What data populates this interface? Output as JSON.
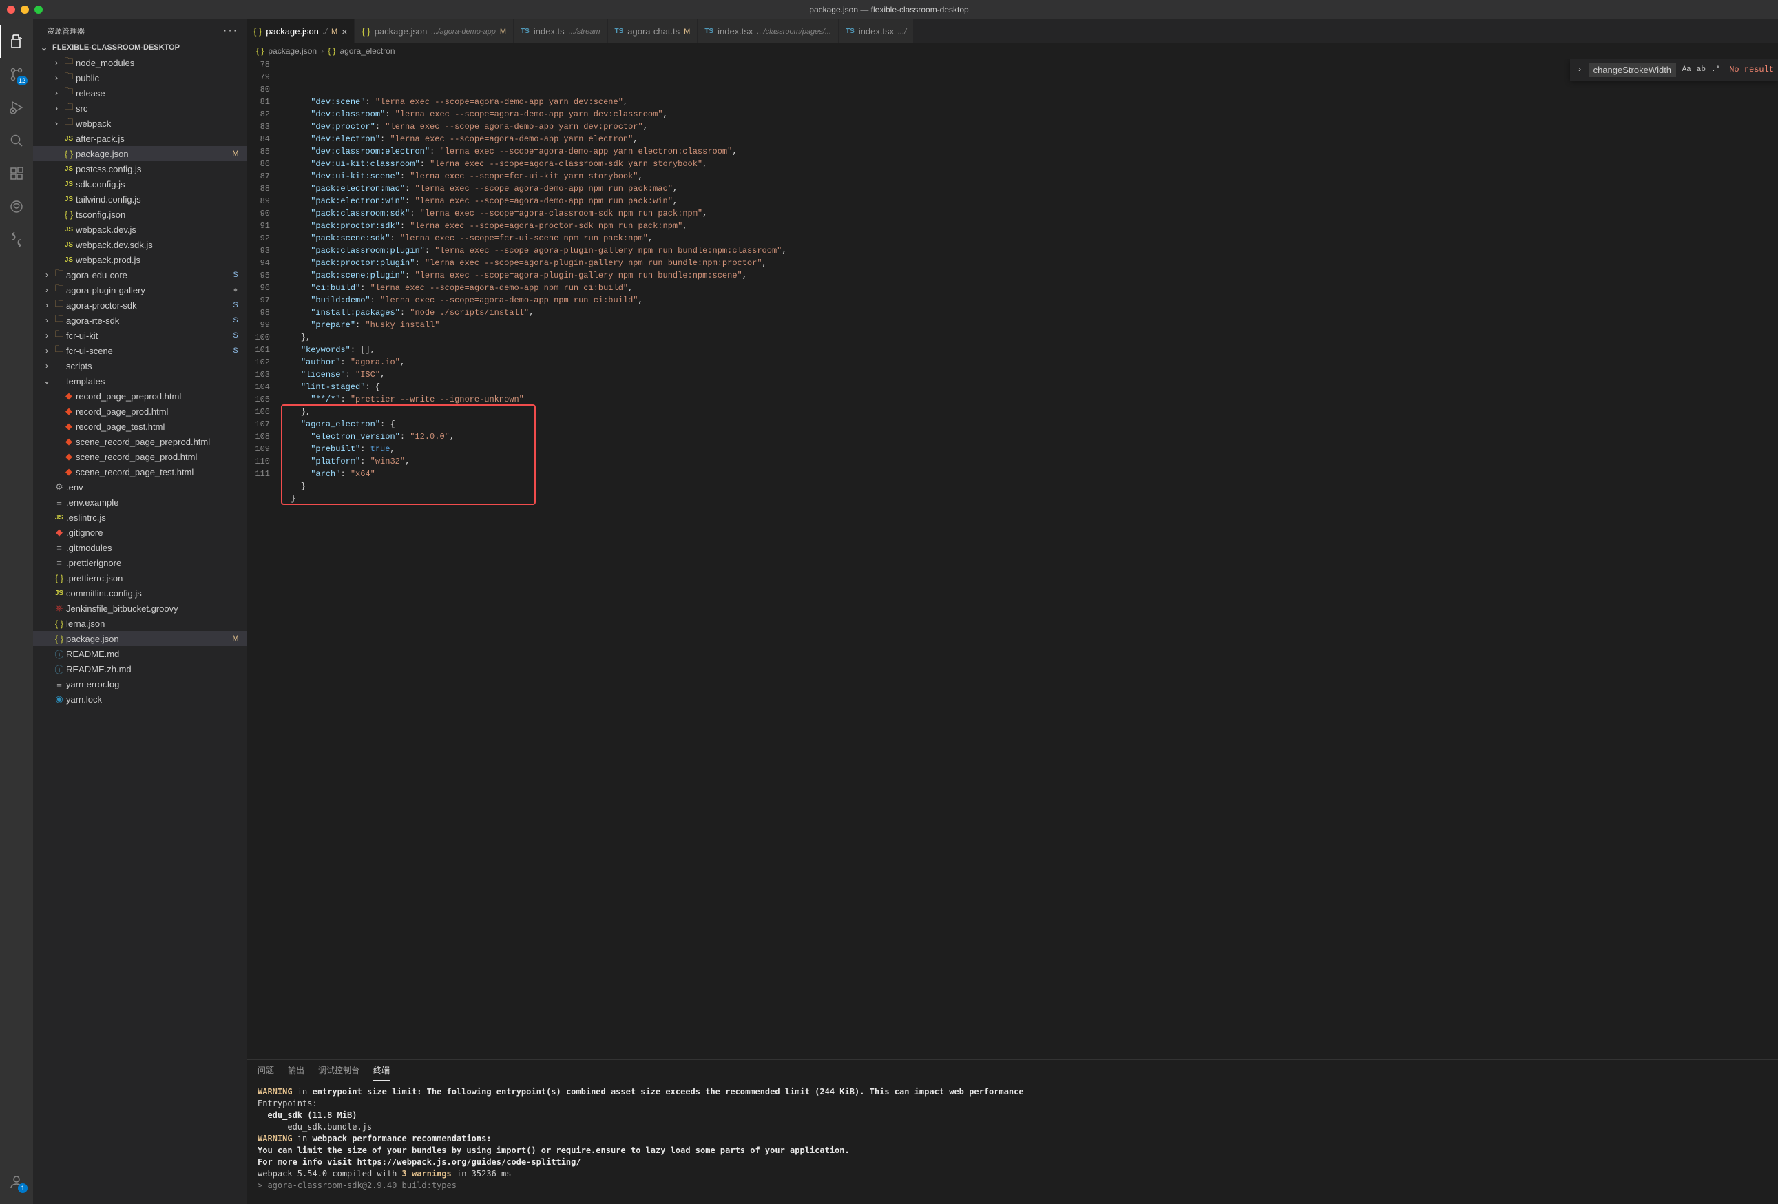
{
  "window": {
    "title": "package.json — flexible-classroom-desktop"
  },
  "sidebar": {
    "title": "资源管理器",
    "folderTitle": "FLEXIBLE-CLASSROOM-DESKTOP",
    "tree": [
      {
        "indent": 1,
        "chev": "›",
        "icon": "folder",
        "name": "node_modules"
      },
      {
        "indent": 1,
        "chev": "›",
        "icon": "folder",
        "name": "public"
      },
      {
        "indent": 1,
        "chev": "›",
        "icon": "folder",
        "name": "release"
      },
      {
        "indent": 1,
        "chev": "›",
        "icon": "folder",
        "name": "src"
      },
      {
        "indent": 1,
        "chev": "›",
        "icon": "folder",
        "name": "webpack"
      },
      {
        "indent": 1,
        "chev": "",
        "icon": "js",
        "name": "after-pack.js"
      },
      {
        "indent": 1,
        "chev": "",
        "icon": "json",
        "name": "package.json",
        "status": "M",
        "statusClass": "status-m",
        "selected": true
      },
      {
        "indent": 1,
        "chev": "",
        "icon": "js",
        "name": "postcss.config.js"
      },
      {
        "indent": 1,
        "chev": "",
        "icon": "js",
        "name": "sdk.config.js"
      },
      {
        "indent": 1,
        "chev": "",
        "icon": "js",
        "name": "tailwind.config.js"
      },
      {
        "indent": 1,
        "chev": "",
        "icon": "json",
        "name": "tsconfig.json"
      },
      {
        "indent": 1,
        "chev": "",
        "icon": "js",
        "name": "webpack.dev.js"
      },
      {
        "indent": 1,
        "chev": "",
        "icon": "js",
        "name": "webpack.dev.sdk.js"
      },
      {
        "indent": 1,
        "chev": "",
        "icon": "js",
        "name": "webpack.prod.js"
      },
      {
        "indent": 0,
        "chev": "›",
        "icon": "folder",
        "name": "agora-edu-core",
        "status": "S",
        "statusClass": "status-s"
      },
      {
        "indent": 0,
        "chev": "›",
        "icon": "folder",
        "name": "agora-plugin-gallery",
        "status": "●",
        "statusClass": "status-dot"
      },
      {
        "indent": 0,
        "chev": "›",
        "icon": "folder",
        "name": "agora-proctor-sdk",
        "status": "S",
        "statusClass": "status-s"
      },
      {
        "indent": 0,
        "chev": "›",
        "icon": "folder",
        "name": "agora-rte-sdk",
        "status": "S",
        "statusClass": "status-s"
      },
      {
        "indent": 0,
        "chev": "›",
        "icon": "folder",
        "name": "fcr-ui-kit",
        "status": "S",
        "statusClass": "status-s"
      },
      {
        "indent": 0,
        "chev": "›",
        "icon": "folder",
        "name": "fcr-ui-scene",
        "status": "S",
        "statusClass": "status-s"
      },
      {
        "indent": 0,
        "chev": "›",
        "icon": "none",
        "name": "scripts"
      },
      {
        "indent": 0,
        "chev": "⌄",
        "icon": "none",
        "name": "templates"
      },
      {
        "indent": 1,
        "chev": "",
        "icon": "html",
        "name": "record_page_preprod.html"
      },
      {
        "indent": 1,
        "chev": "",
        "icon": "html",
        "name": "record_page_prod.html"
      },
      {
        "indent": 1,
        "chev": "",
        "icon": "html",
        "name": "record_page_test.html"
      },
      {
        "indent": 1,
        "chev": "",
        "icon": "html",
        "name": "scene_record_page_preprod.html"
      },
      {
        "indent": 1,
        "chev": "",
        "icon": "html",
        "name": "scene_record_page_prod.html"
      },
      {
        "indent": 1,
        "chev": "",
        "icon": "html",
        "name": "scene_record_page_test.html"
      },
      {
        "indent": 0,
        "chev": "",
        "icon": "env",
        "name": ".env"
      },
      {
        "indent": 0,
        "chev": "",
        "icon": "text",
        "name": ".env.example"
      },
      {
        "indent": 0,
        "chev": "",
        "icon": "js",
        "name": ".eslintrc.js"
      },
      {
        "indent": 0,
        "chev": "",
        "icon": "git",
        "name": ".gitignore"
      },
      {
        "indent": 0,
        "chev": "",
        "icon": "text",
        "name": ".gitmodules"
      },
      {
        "indent": 0,
        "chev": "",
        "icon": "text",
        "name": ".prettierignore"
      },
      {
        "indent": 0,
        "chev": "",
        "icon": "json",
        "name": ".prettierrc.json"
      },
      {
        "indent": 0,
        "chev": "",
        "icon": "js",
        "name": "commitlint.config.js"
      },
      {
        "indent": 0,
        "chev": "",
        "icon": "jenkins",
        "name": "Jenkinsfile_bitbucket.groovy"
      },
      {
        "indent": 0,
        "chev": "",
        "icon": "json",
        "name": "lerna.json"
      },
      {
        "indent": 0,
        "chev": "",
        "icon": "json",
        "name": "package.json",
        "status": "M",
        "statusClass": "status-m",
        "selected": true
      },
      {
        "indent": 0,
        "chev": "",
        "icon": "md",
        "name": "README.md"
      },
      {
        "indent": 0,
        "chev": "",
        "icon": "md",
        "name": "README.zh.md"
      },
      {
        "indent": 0,
        "chev": "",
        "icon": "text",
        "name": "yarn-error.log"
      },
      {
        "indent": 0,
        "chev": "",
        "icon": "yarn",
        "name": "yarn.lock"
      }
    ]
  },
  "tabs": [
    {
      "icon": "json",
      "label": "package.json",
      "desc": "./",
      "status": "M",
      "statusClass": "status-m",
      "close": true,
      "active": true
    },
    {
      "icon": "json",
      "label": "package.json",
      "desc": ".../agora-demo-app",
      "status": "M",
      "statusClass": "status-m"
    },
    {
      "icon": "ts",
      "label": "index.ts",
      "desc": ".../stream"
    },
    {
      "icon": "ts",
      "label": "agora-chat.ts",
      "status": "M",
      "statusClass": "status-m"
    },
    {
      "icon": "ts",
      "label": "index.tsx",
      "desc": ".../classroom/pages/..."
    },
    {
      "icon": "ts",
      "label": "index.tsx",
      "desc": ".../"
    }
  ],
  "breadcrumbs": {
    "a": "package.json",
    "b": "agora_electron"
  },
  "find": {
    "value": "changeStrokeWidth",
    "result": "No result"
  },
  "gutter": {
    "start": 78,
    "end": 111
  },
  "code": [
    "",
    "      \"dev:scene\": \"lerna exec --scope=agora-demo-app yarn dev:scene\",",
    "      \"dev:classroom\": \"lerna exec --scope=agora-demo-app yarn dev:classroom\",",
    "      \"dev:proctor\": \"lerna exec --scope=agora-demo-app yarn dev:proctor\",",
    "      \"dev:electron\": \"lerna exec --scope=agora-demo-app yarn electron\",",
    "      \"dev:classroom:electron\": \"lerna exec --scope=agora-demo-app yarn electron:classroom\",",
    "      \"dev:ui-kit:classroom\": \"lerna exec --scope=agora-classroom-sdk yarn storybook\",",
    "      \"dev:ui-kit:scene\": \"lerna exec --scope=fcr-ui-kit yarn storybook\",",
    "      \"pack:electron:mac\": \"lerna exec --scope=agora-demo-app npm run pack:mac\",",
    "      \"pack:electron:win\": \"lerna exec --scope=agora-demo-app npm run pack:win\",",
    "      \"pack:classroom:sdk\": \"lerna exec --scope=agora-classroom-sdk npm run pack:npm\",",
    "      \"pack:proctor:sdk\": \"lerna exec --scope=agora-proctor-sdk npm run pack:npm\",",
    "      \"pack:scene:sdk\": \"lerna exec --scope=fcr-ui-scene npm run pack:npm\",",
    "      \"pack:classroom:plugin\": \"lerna exec --scope=agora-plugin-gallery npm run bundle:npm:classroom\",",
    "      \"pack:proctor:plugin\": \"lerna exec --scope=agora-plugin-gallery npm run bundle:npm:proctor\",",
    "      \"pack:scene:plugin\": \"lerna exec --scope=agora-plugin-gallery npm run bundle:npm:scene\",",
    "      \"ci:build\": \"lerna exec --scope=agora-demo-app npm run ci:build\",",
    "      \"build:demo\": \"lerna exec --scope=agora-demo-app npm run ci:build\",",
    "      \"install:packages\": \"node ./scripts/install\",",
    "      \"prepare\": \"husky install\"",
    "    },",
    "    \"keywords\": [],",
    "    \"author\": \"agora.io\",",
    "    \"license\": \"ISC\",",
    "    \"lint-staged\": {",
    "      \"**/*\": \"prettier --write --ignore-unknown\"",
    "    },",
    "    \"agora_electron\": {",
    "      \"electron_version\": \"12.0.0\",",
    "      \"prebuilt\": true,",
    "      \"platform\": \"win32\",",
    "      \"arch\": \"x64\"",
    "    }",
    "  }"
  ],
  "highlightedLines": {
    "from": 104,
    "to": 111
  },
  "modifiedLines": {
    "from": 107,
    "to": 109
  },
  "panel": {
    "tabs": [
      "问题",
      "输出",
      "调试控制台",
      "终端"
    ],
    "activeTab": 3,
    "lines": [
      {
        "segs": [
          {
            "t": "WARNING",
            "c": "term-warn"
          },
          {
            "t": " in "
          },
          {
            "t": "entrypoint size limit: The following entrypoint(s) combined asset size exceeds the recommended limit (244 KiB). This can impact web performance",
            "c": "term-bold"
          }
        ]
      },
      {
        "segs": [
          {
            "t": "Entrypoints:"
          }
        ]
      },
      {
        "segs": [
          {
            "t": "  edu_sdk (11.8 MiB)",
            "c": "term-bold"
          }
        ]
      },
      {
        "segs": [
          {
            "t": "      edu_sdk.bundle.js"
          }
        ]
      },
      {
        "segs": [
          {
            "t": ""
          }
        ]
      },
      {
        "segs": [
          {
            "t": ""
          }
        ]
      },
      {
        "segs": [
          {
            "t": "WARNING",
            "c": "term-warn"
          },
          {
            "t": " in "
          },
          {
            "t": "webpack performance recommendations:",
            "c": "term-bold"
          }
        ]
      },
      {
        "segs": [
          {
            "t": "You can limit the size of your bundles by using import() or require.ensure to lazy load some parts of your application.",
            "c": "term-bold"
          }
        ]
      },
      {
        "segs": [
          {
            "t": "For more info visit https://webpack.js.org/guides/code-splitting/",
            "c": "term-bold"
          }
        ]
      },
      {
        "segs": [
          {
            "t": ""
          }
        ]
      },
      {
        "segs": [
          {
            "t": "webpack 5.54.0 compiled with "
          },
          {
            "t": "3 warnings",
            "c": "term-warn"
          },
          {
            "t": " in 35236 ms"
          }
        ]
      },
      {
        "segs": [
          {
            "t": ""
          }
        ]
      },
      {
        "segs": [
          {
            "t": "> agora-classroom-sdk@2.9.40 build:types",
            "c": "term-dim"
          }
        ]
      }
    ]
  },
  "activityBadges": {
    "scm": "12",
    "account": "1"
  }
}
